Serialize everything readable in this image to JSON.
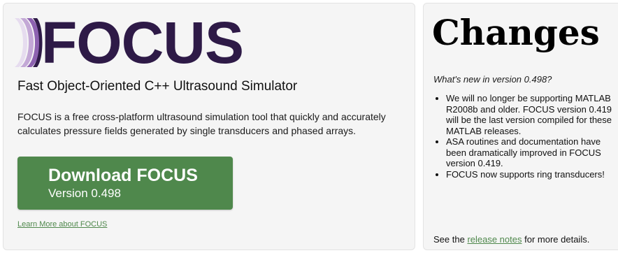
{
  "hero": {
    "logo_text": "FOCUS",
    "logo_mark_colors": [
      "#e6dcef",
      "#c3a8d6",
      "#8d62b0",
      "#2e1a47"
    ],
    "tagline": "Fast Object-Oriented C++ Ultrasound Simulator",
    "description": "FOCUS is a free cross-platform ultrasound simulation tool that quickly and accurately calculates pressure fields generated by single transducers and phased arrays.",
    "download": {
      "title": "Download FOCUS",
      "version": "Version 0.498",
      "color": "#4f884c"
    },
    "learn_more": "Learn More about FOCUS"
  },
  "changes": {
    "title": "Changes",
    "subtitle": "What's new in version 0.498?",
    "items": [
      "We will no longer be supporting MATLAB R2008b and older. FOCUS version 0.419 will be the last version compiled for these MATLAB releases.",
      "ASA routines and documentation have been dramatically improved in FOCUS version 0.419.",
      "FOCUS now supports ring transducers!"
    ],
    "footer_prefix": "See the ",
    "footer_link": "release notes",
    "footer_suffix": " for more details."
  }
}
